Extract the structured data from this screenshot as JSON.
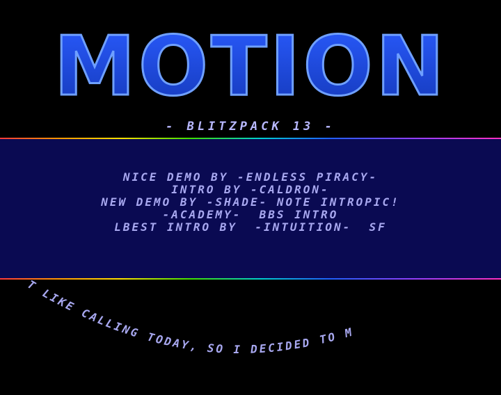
{
  "logo": {
    "text": "MOTION",
    "color": "#1a4ad8",
    "outline": "#7fb0ff"
  },
  "subtitle": "- BLITZPACK 13 -",
  "text_lines": [
    "NICE DEMO BY -ENDLESS PIRACY-",
    "INTRO BY -CALDRON-",
    "NEW DEMO BY -SHADE- NOTE INTROPIC!",
    "-ACADEMY-  BBS INTRO",
    "LBEST INTRO BY  -INTUITION-  SF"
  ],
  "sine_scroller": "T LIKE CALLING TODAY, SO I DECIDED TO M",
  "colors": {
    "background": "#000000",
    "panel": "#0a0a52",
    "text": "#a8a8f0"
  }
}
